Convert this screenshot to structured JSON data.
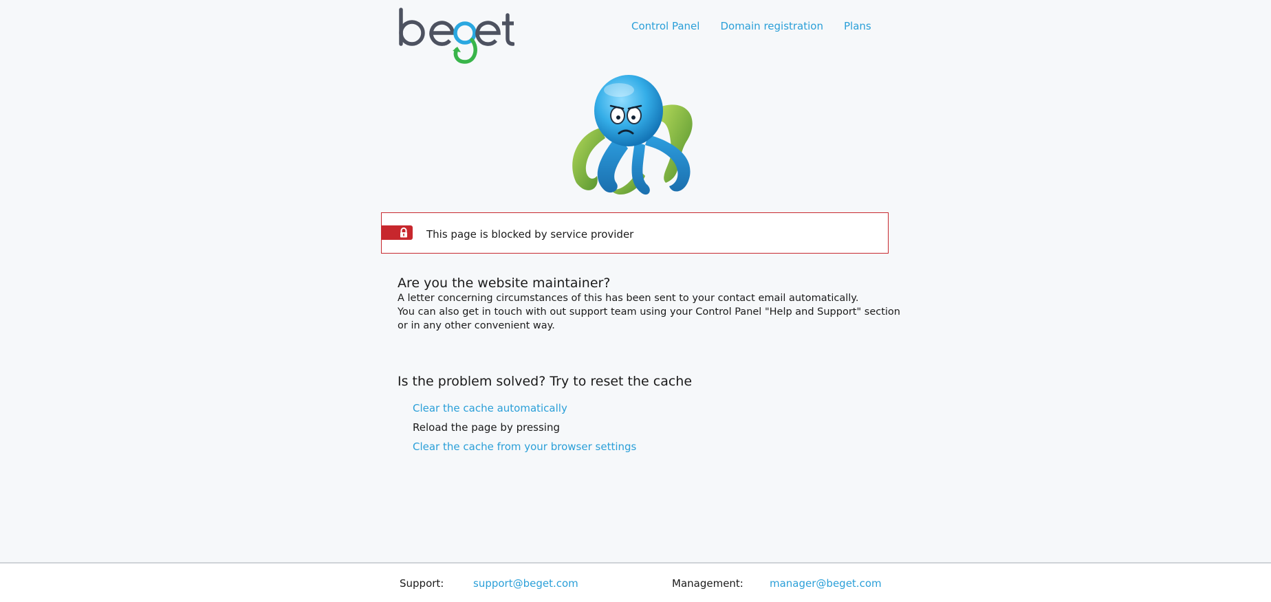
{
  "header": {
    "logo_text": "beget",
    "nav": [
      {
        "label": "Control Panel"
      },
      {
        "label": "Domain registration"
      },
      {
        "label": "Plans"
      }
    ]
  },
  "alert": {
    "message": "This page is blocked by service provider",
    "color": "#c7272d"
  },
  "maintainer": {
    "heading": "Are you the website maintainer?",
    "lines": [
      "A letter concerning circumstances of this has been sent to your contact email automatically.",
      "You can also get in touch with out support team using your Control Panel \"Help and Support\" section",
      "or in any other convenient way."
    ]
  },
  "cache": {
    "heading": "Is the problem solved? Try to reset the cache",
    "items": [
      {
        "label": "Clear the cache automatically",
        "link": true
      },
      {
        "label": "Reload the page by pressing",
        "link": false
      },
      {
        "label": "Clear the cache from your browser settings",
        "link": true
      }
    ]
  },
  "footer": {
    "support_label": "Support:",
    "support_email": "support@beget.com",
    "management_label": "Management:",
    "management_email": "manager@beget.com"
  },
  "colors": {
    "link": "#2a9fd8",
    "background": "#f6f8fa"
  }
}
